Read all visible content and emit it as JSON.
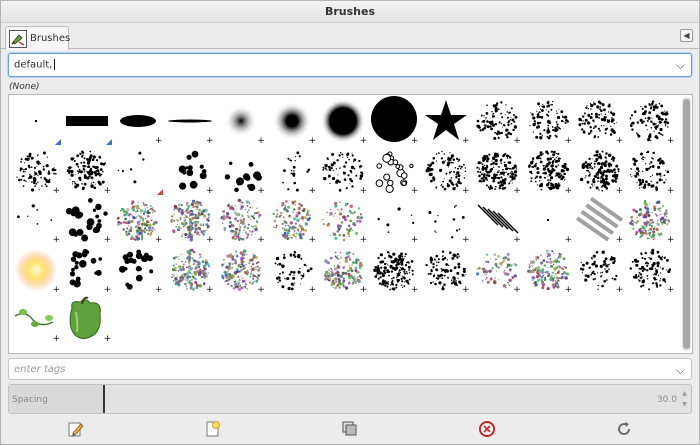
{
  "window": {
    "title": "Brushes"
  },
  "tabs": [
    {
      "label": "Brushes",
      "icon": "brushes-icon"
    }
  ],
  "filter": {
    "value": "default,"
  },
  "selection_label": "(None)",
  "brushes": [
    {
      "name": "brush-pixel",
      "kind": "dot",
      "mark": "tri-blue"
    },
    {
      "name": "brush-block-01",
      "kind": "block",
      "mark": "tri-blue"
    },
    {
      "name": "brush-block-02",
      "kind": "ellipse",
      "mark": "+"
    },
    {
      "name": "brush-block-03",
      "kind": "line",
      "mark": "+"
    },
    {
      "name": "brush-2-hardness-025",
      "kind": "fuzzy",
      "mark": "+"
    },
    {
      "name": "brush-2-hardness-050",
      "kind": "fuzzy2",
      "mark": "+"
    },
    {
      "name": "brush-2-hardness-075",
      "kind": "fuzzy3",
      "mark": "+"
    },
    {
      "name": "brush-2-hardness-100",
      "kind": "circle",
      "mark": "+"
    },
    {
      "name": "brush-2-star",
      "kind": "star",
      "mark": "+"
    },
    {
      "name": "brush-acrylic-01",
      "kind": "texture",
      "mark": "+"
    },
    {
      "name": "brush-acrylic-02",
      "kind": "texture",
      "mark": "+"
    },
    {
      "name": "brush-acrylic-03",
      "kind": "texture",
      "mark": "+"
    },
    {
      "name": "brush-acrylic-04",
      "kind": "texture",
      "mark": "+"
    },
    {
      "name": "brush-acrylic-05",
      "kind": "texture2",
      "mark": "+"
    },
    {
      "name": "brush-chalk-01",
      "kind": "scatter",
      "mark": "+"
    },
    {
      "name": "brush-chalk-02",
      "kind": "faint",
      "mark": "tri-red"
    },
    {
      "name": "brush-chalk-03",
      "kind": "blobs",
      "mark": "+"
    },
    {
      "name": "brush-charcoal-01",
      "kind": "blobs2",
      "mark": "+"
    },
    {
      "name": "brush-charcoal-02",
      "kind": "dots",
      "mark": "+"
    },
    {
      "name": "brush-charcoal-03",
      "kind": "cracks",
      "mark": "+"
    },
    {
      "name": "brush-cells",
      "kind": "cells",
      "mark": "+"
    },
    {
      "name": "brush-confetti",
      "kind": "texture",
      "mark": "+"
    },
    {
      "name": "brush-grunge-01",
      "kind": "roundtex",
      "mark": "+"
    },
    {
      "name": "brush-grunge-02",
      "kind": "roundtex2",
      "mark": "+"
    },
    {
      "name": "brush-grunge-03",
      "kind": "smear",
      "mark": "+"
    },
    {
      "name": "brush-grunge-04",
      "kind": "smear2",
      "mark": "+"
    },
    {
      "name": "brush-hatch",
      "kind": "sticks",
      "mark": "+"
    },
    {
      "name": "brush-oils-01",
      "kind": "blots",
      "mark": "+"
    },
    {
      "name": "brush-oils-02",
      "kind": "sponge",
      "mark": "+"
    },
    {
      "name": "brush-oils-03",
      "kind": "sponge",
      "mark": "+"
    },
    {
      "name": "brush-pencil-01",
      "kind": "gray",
      "mark": "+"
    },
    {
      "name": "brush-pencil-02",
      "kind": "gray",
      "mark": "+"
    },
    {
      "name": "brush-pencil-03",
      "kind": "faintgray",
      "mark": "+"
    },
    {
      "name": "brush-pepper",
      "kind": "speck",
      "mark": "+"
    },
    {
      "name": "brush-sand",
      "kind": "speck2",
      "mark": "+"
    },
    {
      "name": "brush-smoke",
      "kind": "hatch",
      "mark": "+"
    },
    {
      "name": "brush-spark",
      "kind": "dot",
      "mark": "+"
    },
    {
      "name": "brush-sponge-01",
      "kind": "grad",
      "mark": "+"
    },
    {
      "name": "brush-sponge-02",
      "kind": "grayball",
      "mark": "+"
    },
    {
      "name": "brush-sponge-03",
      "kind": "glow",
      "mark": "+"
    },
    {
      "name": "brush-splats-01",
      "kind": "splats",
      "mark": "+"
    },
    {
      "name": "brush-splats-02",
      "kind": "splats2",
      "mark": "+"
    },
    {
      "name": "brush-splats-03",
      "kind": "sponge",
      "mark": "+"
    },
    {
      "name": "brush-splats-04",
      "kind": "sponge",
      "mark": "+"
    },
    {
      "name": "brush-stroke-01",
      "kind": "strokes",
      "mark": "+"
    },
    {
      "name": "brush-stroke-02",
      "kind": "grayball",
      "mark": "+"
    },
    {
      "name": "brush-stroke-03",
      "kind": "roundtex",
      "mark": "+"
    },
    {
      "name": "brush-texture-01",
      "kind": "fibers",
      "mark": "+"
    },
    {
      "name": "brush-texture-02",
      "kind": "faintgray",
      "mark": "+"
    },
    {
      "name": "brush-texture-03",
      "kind": "grayball",
      "mark": "+"
    },
    {
      "name": "brush-texture-04",
      "kind": "flower",
      "mark": "+"
    },
    {
      "name": "brush-texture-05",
      "kind": "leafy",
      "mark": "+"
    },
    {
      "name": "brush-vine",
      "kind": "vine",
      "mark": "+"
    },
    {
      "name": "brush-pepper-photo",
      "kind": "pepper",
      "mark": "+"
    }
  ],
  "tags": {
    "placeholder": "enter tags"
  },
  "spacing": {
    "label": "Spacing",
    "value": "30.0",
    "fraction": 0.14
  },
  "toolbar": [
    {
      "name": "edit-brush-button",
      "icon": "pencil-icon"
    },
    {
      "name": "new-brush-button",
      "icon": "new-document-icon"
    },
    {
      "name": "duplicate-brush-button",
      "icon": "duplicate-icon"
    },
    {
      "name": "delete-brush-button",
      "icon": "delete-icon"
    },
    {
      "name": "refresh-brushes-button",
      "icon": "refresh-icon"
    }
  ]
}
